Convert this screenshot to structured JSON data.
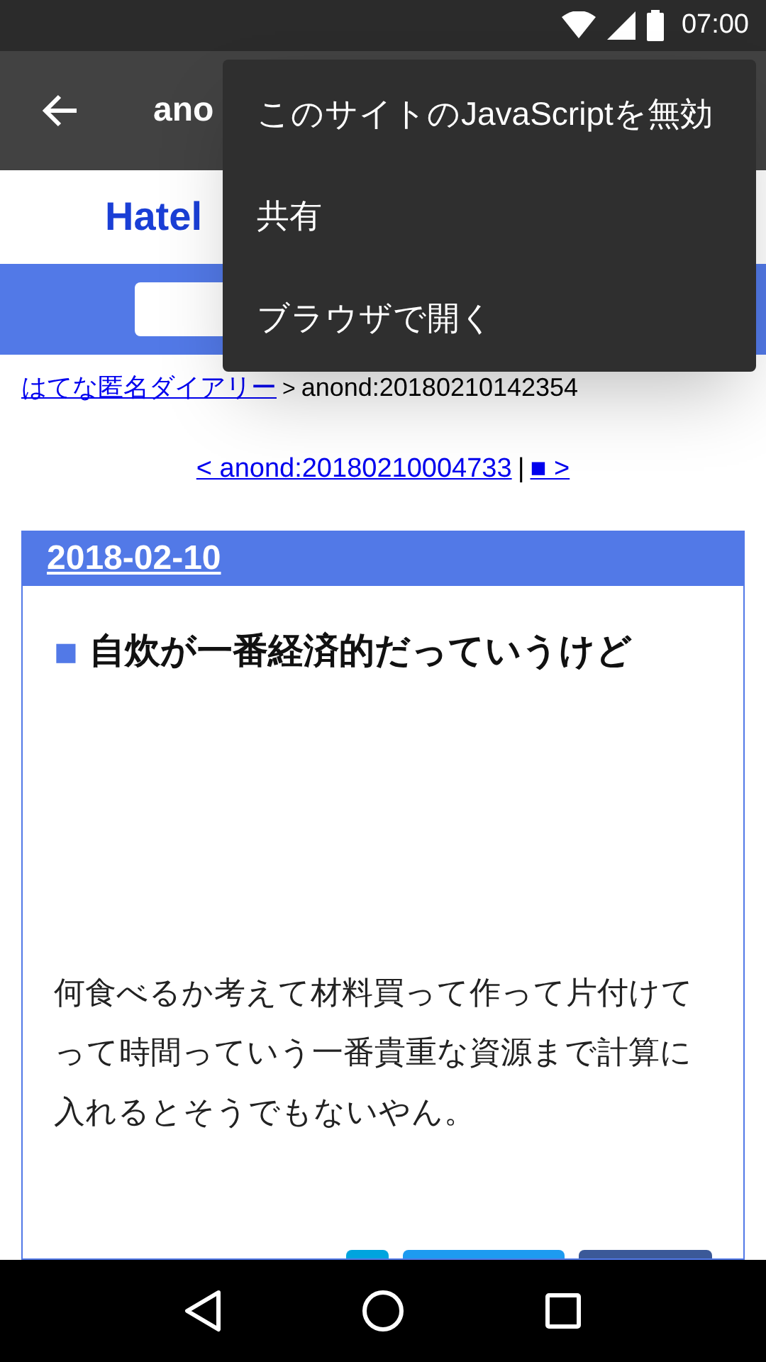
{
  "status_bar": {
    "time": "07:00"
  },
  "app_bar": {
    "title": "ano"
  },
  "site": {
    "logo": "Hatel"
  },
  "breadcrumb": {
    "link": "はてな匿名ダイアリー",
    "separator": ">",
    "current": "anond:20180210142354"
  },
  "pager": {
    "prev": "< anond:20180210004733",
    "divider": "|",
    "next": "■ >"
  },
  "entry": {
    "date": "2018-02-10",
    "marker": "■",
    "title": "自炊が一番経済的だっていうけど",
    "body": "何食べるか考えて材料買って作って片付けてって時間っていう一番貴重な資源まで計算に入れるとそうでもないやん。"
  },
  "menu": {
    "items": [
      "このサイトのJavaScriptを無効",
      "共有",
      "ブラウザで開く"
    ]
  }
}
